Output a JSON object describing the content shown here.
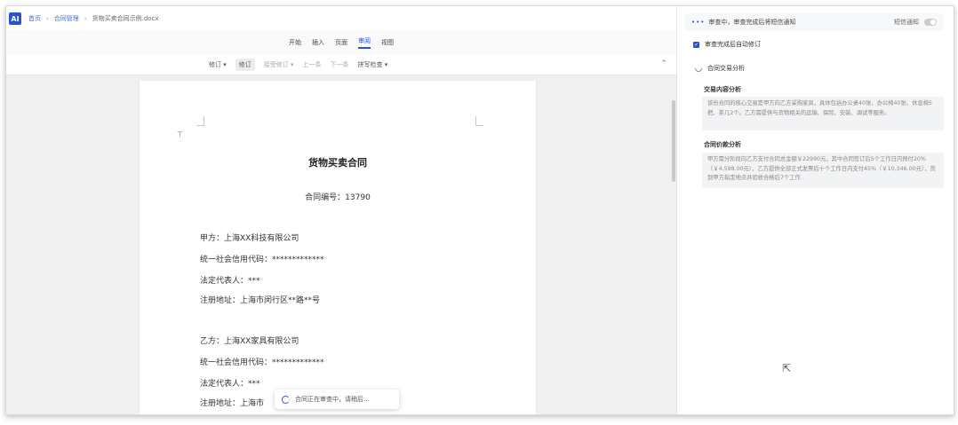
{
  "topbar": {
    "logo": "AI",
    "breadcrumb": [
      "首页",
      "合同管理",
      "货物买卖合同示例.docx"
    ]
  },
  "menu": {
    "tabs": [
      "开始",
      "插入",
      "页面",
      "审阅",
      "视图"
    ],
    "active": "审阅"
  },
  "toolbar": {
    "items": [
      "修订 ▾",
      "修订",
      "接受修订 ▾",
      "上一条",
      "下一条",
      "拼写检查 ▾"
    ]
  },
  "document": {
    "title": "货物买卖合同",
    "contract_no": "合同编号：13790",
    "party_a": [
      "甲方：上海XX科技有限公司",
      "统一社会信用代码：*************",
      "法定代表人：***",
      "注册地址：上海市闵行区**路**号"
    ],
    "party_b": [
      "乙方：上海XX家具有限公司",
      "统一社会信用代码：*************",
      "法定代表人：***",
      "注册地址：上海市"
    ],
    "status_popup": "合同正在审查中，请稍后..."
  },
  "panel": {
    "status_text": "审查中，审查完成后将短信通知",
    "sms_label": "短信通知",
    "auto_revise_label": "审查完成后自动修订",
    "section_title": "合同交易分析",
    "content_title": "交易内容分析",
    "content_text": "该份合同的核心交易是甲方向乙方采购家具，具体包括办公桌40张、办公椅40张、休息椅5把、茶几2个。乙方需提供与货物相关的运输、保险、安装、调试等服务。",
    "price_title": "合同价款分析",
    "price_text": "甲方需分阶段向乙方支付合同总金额￥22990元，其中合同签订后5个工作日内预付20%（￥4,598.00元），乙方提供全部正式发票后十个工作日内支付45%（￥10,346.00元），货到甲方指定地点并验收合格后7个工作"
  },
  "colors": {
    "accent": "#2b52d6"
  }
}
